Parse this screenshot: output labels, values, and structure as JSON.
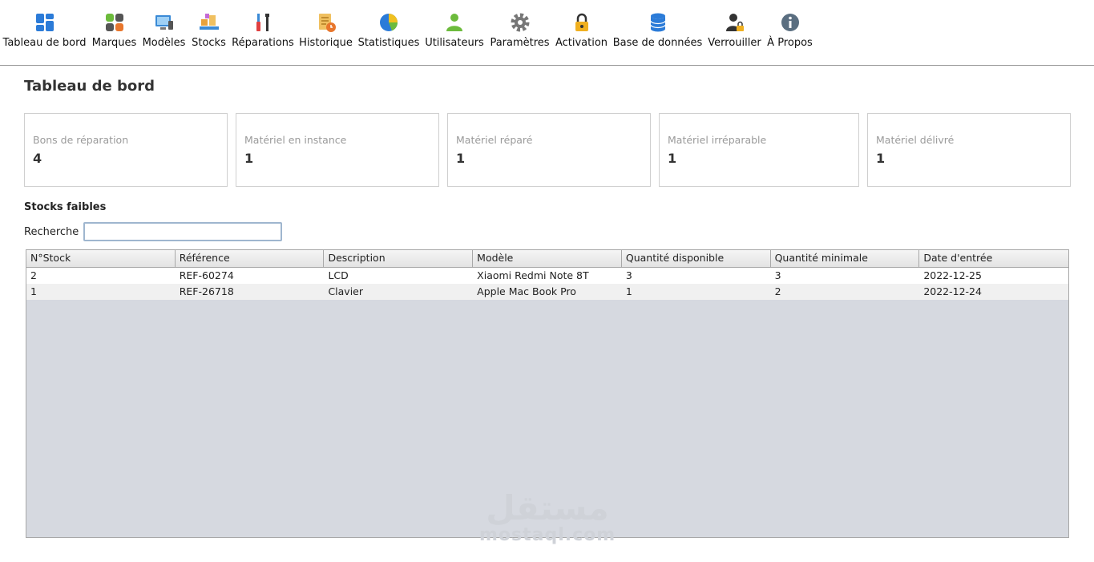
{
  "toolbar": {
    "items": [
      {
        "label": "Tableau de bord",
        "icon": "dashboard-icon"
      },
      {
        "label": "Marques",
        "icon": "brands-icon"
      },
      {
        "label": "Modèles",
        "icon": "models-icon"
      },
      {
        "label": "Stocks",
        "icon": "stocks-icon"
      },
      {
        "label": "Réparations",
        "icon": "tools-icon"
      },
      {
        "label": "Historique",
        "icon": "history-icon"
      },
      {
        "label": "Statistiques",
        "icon": "pie-chart-icon"
      },
      {
        "label": "Utilisateurs",
        "icon": "user-icon"
      },
      {
        "label": "Paramètres",
        "icon": "gear-icon"
      },
      {
        "label": "Activation",
        "icon": "lock-icon"
      },
      {
        "label": "Base de données",
        "icon": "database-icon"
      },
      {
        "label": "Verrouiller",
        "icon": "user-lock-icon"
      },
      {
        "label": "À Propos",
        "icon": "info-icon"
      }
    ]
  },
  "page": {
    "title": "Tableau de bord"
  },
  "cards": [
    {
      "label": "Bons de réparation",
      "value": "4"
    },
    {
      "label": "Matériel en instance",
      "value": "1"
    },
    {
      "label": "Matériel réparé",
      "value": "1"
    },
    {
      "label": "Matériel irréparable",
      "value": "1"
    },
    {
      "label": "Matériel délivré",
      "value": "1"
    }
  ],
  "low_stock": {
    "title": "Stocks faibles",
    "search_label": "Recherche",
    "search_value": "",
    "columns": [
      "N°Stock",
      "Référence",
      "Description",
      "Modèle",
      "Quantité disponible",
      "Quantité minimale",
      "Date d'entrée"
    ],
    "rows": [
      [
        "2",
        "REF-60274",
        "LCD",
        "Xiaomi Redmi Note 8T",
        "3",
        "3",
        "2022-12-25"
      ],
      [
        "1",
        "REF-26718",
        "Clavier",
        "Apple Mac Book Pro",
        "1",
        "2",
        "2022-12-24"
      ]
    ]
  },
  "watermark": {
    "arabic": "مستقل",
    "latin": "mostaql.com"
  },
  "colors": {
    "accent_blue": "#2b7bd8",
    "green": "#6cbb3c",
    "orange": "#e8762c",
    "table_bg": "#d6d9e0"
  }
}
